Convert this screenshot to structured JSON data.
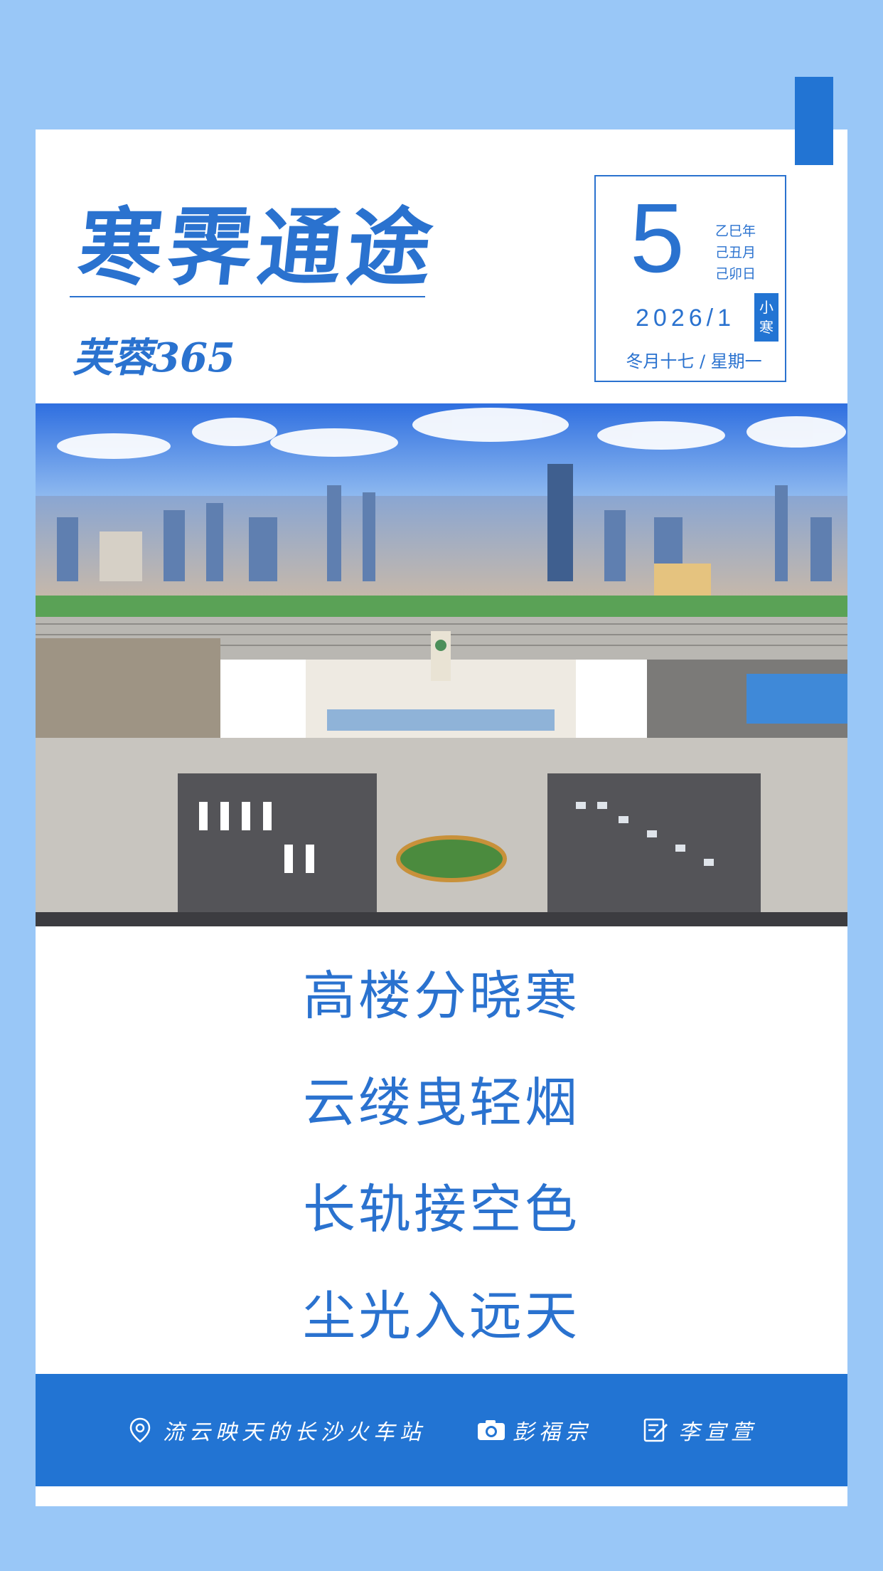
{
  "header": {
    "title": "寒霁通途",
    "subtitle": "芙蓉365"
  },
  "date": {
    "day": "5",
    "ganzhi": [
      "乙巳年",
      "己丑月",
      "己卯日"
    ],
    "date_line": "2026/1",
    "solar_term": [
      "小",
      "寒"
    ],
    "lunar": "冬月十七  /  星期一"
  },
  "poem": {
    "lines": [
      "高楼分晓寒",
      "云缕曳轻烟",
      "长轨接空色",
      "尘光入远天"
    ]
  },
  "footer": {
    "location": "流云映天的长沙火车站",
    "photographer": "彭福宗",
    "writer": "李宣萱",
    "icons": [
      "location-pin-icon",
      "camera-icon",
      "edit-note-icon"
    ]
  },
  "colors": {
    "background": "#99c7f7",
    "accent": "#2274d3",
    "text": "#2a72cf",
    "card": "#ffffff"
  }
}
